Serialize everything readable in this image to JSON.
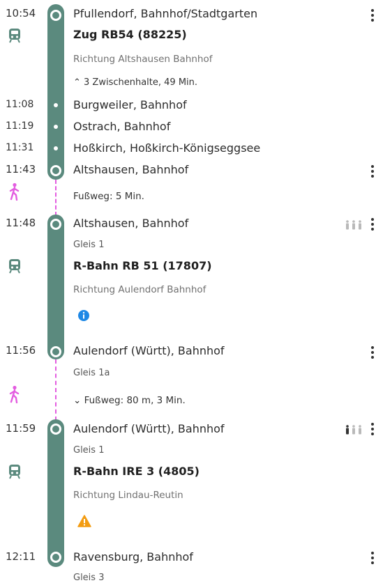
{
  "leg1": {
    "dep_time": "10:54",
    "dep_station": "Pfullendorf, Bahnhof/Stadtgarten",
    "train": "Zug RB54 (88225)",
    "direction": "Richtung Altshausen Bahnhof",
    "intermediate_toggle": "⌃ 3 Zwischenhalte, 49 Min.",
    "stops": [
      {
        "time": "11:08",
        "name": "Burgweiler, Bahnhof"
      },
      {
        "time": "11:19",
        "name": "Ostrach, Bahnhof"
      },
      {
        "time": "11:31",
        "name": "Hoßkirch, Hoßkirch-Königseggsee"
      }
    ],
    "arr_time": "11:43",
    "arr_station": "Altshausen, Bahnhof"
  },
  "walk1": {
    "text": "Fußweg: 5 Min."
  },
  "leg2": {
    "dep_time": "11:48",
    "dep_station": "Altshausen, Bahnhof",
    "dep_platform": "Gleis 1",
    "train": "R-Bahn RB 51 (17807)",
    "direction": "Richtung Aulendorf Bahnhof",
    "arr_time": "11:56",
    "arr_station": "Aulendorf (Württ), Bahnhof",
    "arr_platform": "Gleis 1a",
    "occupancy_level": 0
  },
  "walk2": {
    "text": "⌄ Fußweg: 80 m, 3 Min."
  },
  "leg3": {
    "dep_time": "11:59",
    "dep_station": "Aulendorf (Württ), Bahnhof",
    "dep_platform": "Gleis 1",
    "train": "R-Bahn IRE 3 (4805)",
    "direction": "Richtung Lindau-Reutin",
    "arr_time": "12:11",
    "arr_station": "Ravensburg, Bahnhof",
    "arr_platform": "Gleis 3",
    "occupancy_level": 1
  },
  "colors": {
    "line": "#5b8a7e",
    "walk": "#e35ce0",
    "info": "#1e88e5",
    "warning": "#f39c12"
  },
  "icons": [
    "train-icon",
    "walk-icon",
    "info-icon",
    "warning-icon",
    "occupancy-icon",
    "more-options-icon"
  ]
}
